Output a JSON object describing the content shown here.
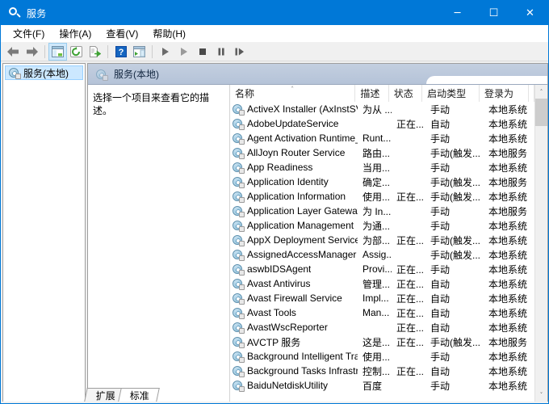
{
  "window": {
    "title": "服务",
    "title_icon": "services-magnifier-icon",
    "minimize_glyph": "─",
    "maximize_glyph": "☐",
    "close_glyph": "✕"
  },
  "menubar": {
    "items": [
      {
        "label": "文件(F)",
        "name": "menu-file"
      },
      {
        "label": "操作(A)",
        "name": "menu-action"
      },
      {
        "label": "查看(V)",
        "name": "menu-view"
      },
      {
        "label": "帮助(H)",
        "name": "menu-help"
      }
    ]
  },
  "toolbar": {
    "buttons": [
      {
        "name": "back-button",
        "icon": "back-arrow-icon"
      },
      {
        "name": "forward-button",
        "icon": "forward-arrow-icon"
      },
      {
        "name": "show-hide-console-tree-button",
        "icon": "console-tree-icon"
      },
      {
        "name": "refresh-button",
        "icon": "refresh-icon"
      },
      {
        "name": "export-list-button",
        "icon": "export-list-icon"
      },
      {
        "name": "help-button",
        "icon": "question-mark-icon"
      },
      {
        "name": "show-action-pane-button",
        "icon": "action-pane-icon"
      },
      {
        "name": "start-service-button",
        "icon": "play-icon"
      },
      {
        "name": "restart-service-button",
        "icon": "play-gray-icon"
      },
      {
        "name": "stop-service-button",
        "icon": "stop-square-icon"
      },
      {
        "name": "pause-service-button",
        "icon": "pause-icon"
      },
      {
        "name": "resume-service-button",
        "icon": "resume-icon"
      }
    ]
  },
  "tree": {
    "items": [
      {
        "label": "服务(本地)",
        "name": "tree-item-services-local",
        "icon": "services-icon",
        "selected": true
      }
    ]
  },
  "pane": {
    "header": "服务(本地)",
    "header_icon": "services-icon",
    "description_placeholder": "选择一个项目来查看它的描述。"
  },
  "list": {
    "columns": [
      {
        "label": "名称",
        "name": "column-name",
        "sorted": "asc"
      },
      {
        "label": "描述",
        "name": "column-description"
      },
      {
        "label": "状态",
        "name": "column-status"
      },
      {
        "label": "启动类型",
        "name": "column-startup-type"
      },
      {
        "label": "登录为",
        "name": "column-log-on-as"
      }
    ],
    "sort_indicator": "˄",
    "rows": [
      {
        "name": "ActiveX Installer (AxInstSV)",
        "desc": "为从 ...",
        "status": "",
        "startup": "手动",
        "logon": "本地系统"
      },
      {
        "name": "AdobeUpdateService",
        "desc": "",
        "status": "正在...",
        "startup": "自动",
        "logon": "本地系统"
      },
      {
        "name": "Agent Activation Runtime_...",
        "desc": "Runt...",
        "status": "",
        "startup": "手动",
        "logon": "本地系统"
      },
      {
        "name": "AllJoyn Router Service",
        "desc": "路由...",
        "status": "",
        "startup": "手动(触发...",
        "logon": "本地服务"
      },
      {
        "name": "App Readiness",
        "desc": "当用...",
        "status": "",
        "startup": "手动",
        "logon": "本地系统"
      },
      {
        "name": "Application Identity",
        "desc": "确定...",
        "status": "",
        "startup": "手动(触发...",
        "logon": "本地服务"
      },
      {
        "name": "Application Information",
        "desc": "使用...",
        "status": "正在...",
        "startup": "手动(触发...",
        "logon": "本地系统"
      },
      {
        "name": "Application Layer Gateway ...",
        "desc": "为 In...",
        "status": "",
        "startup": "手动",
        "logon": "本地服务"
      },
      {
        "name": "Application Management",
        "desc": "为通...",
        "status": "",
        "startup": "手动",
        "logon": "本地系统"
      },
      {
        "name": "AppX Deployment Service ...",
        "desc": "为部...",
        "status": "正在...",
        "startup": "手动(触发...",
        "logon": "本地系统"
      },
      {
        "name": "AssignedAccessManager ...",
        "desc": "Assig...",
        "status": "",
        "startup": "手动(触发...",
        "logon": "本地系统"
      },
      {
        "name": "aswbIDSAgent",
        "desc": "Provi...",
        "status": "正在...",
        "startup": "手动",
        "logon": "本地系统"
      },
      {
        "name": "Avast Antivirus",
        "desc": "管理...",
        "status": "正在...",
        "startup": "自动",
        "logon": "本地系统"
      },
      {
        "name": "Avast Firewall Service",
        "desc": "Impl...",
        "status": "正在...",
        "startup": "自动",
        "logon": "本地系统"
      },
      {
        "name": "Avast Tools",
        "desc": "Man...",
        "status": "正在...",
        "startup": "自动",
        "logon": "本地系统"
      },
      {
        "name": "AvastWscReporter",
        "desc": "",
        "status": "正在...",
        "startup": "自动",
        "logon": "本地系统"
      },
      {
        "name": "AVCTP 服务",
        "desc": "这是...",
        "status": "正在...",
        "startup": "手动(触发...",
        "logon": "本地服务"
      },
      {
        "name": "Background Intelligent Tra...",
        "desc": "使用...",
        "status": "",
        "startup": "手动",
        "logon": "本地系统"
      },
      {
        "name": "Background Tasks Infrastru...",
        "desc": "控制...",
        "status": "正在...",
        "startup": "自动",
        "logon": "本地系统"
      },
      {
        "name": "BaiduNetdiskUtility",
        "desc": "百度",
        "status": "",
        "startup": "手动",
        "logon": "本地系统"
      }
    ],
    "scrollbar": {
      "up_glyph": "˄",
      "down_glyph": "˅"
    }
  },
  "tabs": [
    {
      "label": "扩展",
      "name": "tab-extended",
      "active": false
    },
    {
      "label": "标准",
      "name": "tab-standard",
      "active": true
    }
  ]
}
